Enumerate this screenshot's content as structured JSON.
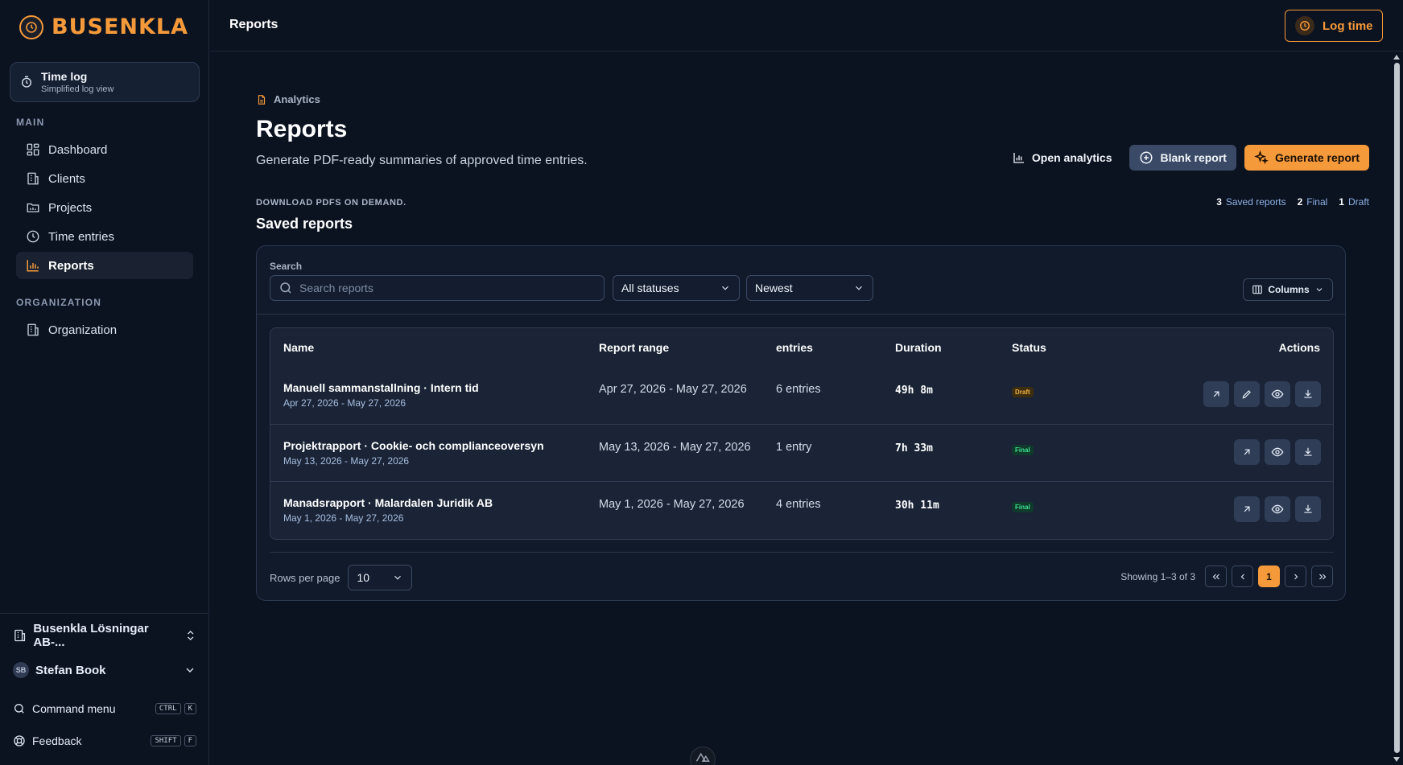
{
  "app": {
    "logo_text": "BUSENKLA",
    "brand_color": "#f59a3a"
  },
  "sidebar": {
    "timelog": {
      "title": "Time log",
      "subtitle": "Simplified log view"
    },
    "main_label": "MAIN",
    "main_items": [
      {
        "label": "Dashboard",
        "icon": "dashboard-icon"
      },
      {
        "label": "Clients",
        "icon": "building-icon"
      },
      {
        "label": "Projects",
        "icon": "folder-icon"
      },
      {
        "label": "Time entries",
        "icon": "clock-icon"
      },
      {
        "label": "Reports",
        "icon": "bar-chart-icon",
        "active": true
      }
    ],
    "org_label": "ORGANIZATION",
    "org_items": [
      {
        "label": "Organization",
        "icon": "building-icon"
      }
    ],
    "org_switcher": "Busenkla Lösningar AB-...",
    "user": {
      "initials": "SB",
      "name": "Stefan Book"
    },
    "command_menu": {
      "label": "Command menu",
      "keys": [
        "CTRL",
        "K"
      ]
    },
    "feedback": {
      "label": "Feedback",
      "keys": [
        "SHIFT",
        "F"
      ]
    }
  },
  "topbar": {
    "title": "Reports",
    "log_time": "Log time"
  },
  "page": {
    "breadcrumb": "Analytics",
    "title": "Reports",
    "subtitle": "Generate PDF-ready summaries of approved time entries.",
    "buttons": {
      "open_analytics": "Open analytics",
      "blank_report": "Blank report",
      "generate_report": "Generate report"
    },
    "caps_label": "DOWNLOAD PDFS ON DEMAND.",
    "section_title": "Saved reports",
    "stats": [
      {
        "count": "3",
        "label": "Saved reports"
      },
      {
        "count": "2",
        "label": "Final"
      },
      {
        "count": "1",
        "label": "Draft"
      }
    ]
  },
  "filters": {
    "search_label": "Search",
    "search_placeholder": "Search reports",
    "status_value": "All statuses",
    "sort_value": "Newest",
    "columns": "Columns"
  },
  "table": {
    "headers": {
      "name": "Name",
      "range": "Report range",
      "entries": "entries",
      "duration": "Duration",
      "status": "Status",
      "actions": "Actions"
    },
    "rows": [
      {
        "name": "Manuell sammanstallning · Intern tid",
        "sub": "Apr 27, 2026 - May 27, 2026",
        "range": "Apr 27, 2026 - May 27, 2026",
        "entries": "6 entries",
        "duration": "49h 8m",
        "status": "Draft"
      },
      {
        "name": "Projektrapport · Cookie- och complianceoversyn",
        "sub": "May 13, 2026 - May 27, 2026",
        "range": "May 13, 2026 - May 27, 2026",
        "entries": "1 entry",
        "duration": "7h 33m",
        "status": "Final"
      },
      {
        "name": "Manadsrapport · Malardalen Juridik AB",
        "sub": "May 1, 2026 - May 27, 2026",
        "range": "May 1, 2026 - May 27, 2026",
        "entries": "4 entries",
        "duration": "30h 11m",
        "status": "Final"
      }
    ]
  },
  "pagination": {
    "rows_label": "Rows per page",
    "rows_value": "10",
    "showing": "Showing 1–3 of 3",
    "current_page": "1"
  }
}
